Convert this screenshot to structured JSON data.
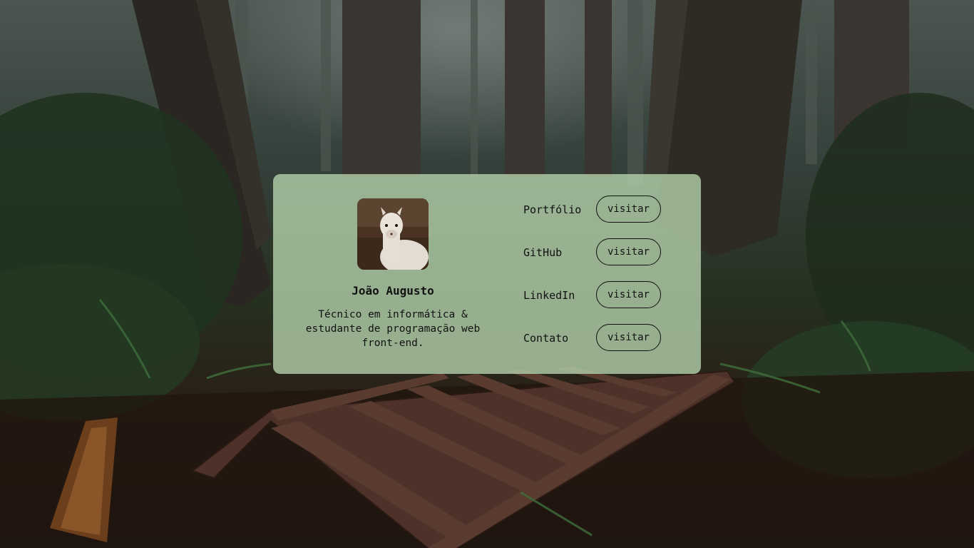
{
  "profile": {
    "name": "João Augusto",
    "bio": "Técnico em informática & estudante de programação web front-end."
  },
  "links": [
    {
      "label": "Portfólio",
      "button": "visitar"
    },
    {
      "label": "GitHub",
      "button": "visitar"
    },
    {
      "label": "LinkedIn",
      "button": "visitar"
    },
    {
      "label": "Contato",
      "button": "visitar"
    }
  ],
  "colors": {
    "card": "#b0cda8",
    "text": "#111111"
  }
}
